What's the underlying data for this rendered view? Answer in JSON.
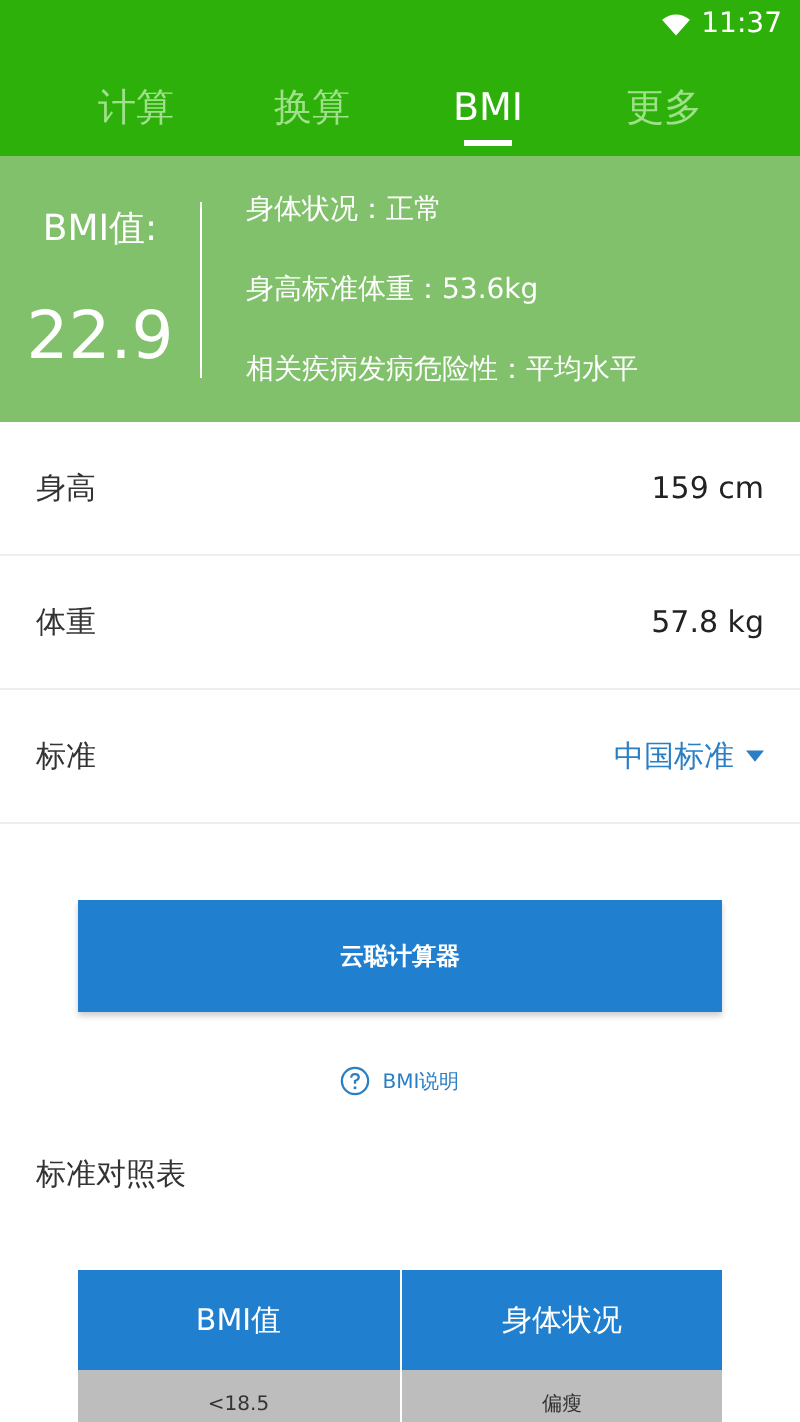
{
  "status_bar": {
    "time": "11:37"
  },
  "tabs": [
    {
      "label": "计算",
      "selected": false
    },
    {
      "label": "换算",
      "selected": false
    },
    {
      "label": "BMI",
      "selected": true
    },
    {
      "label": "更多",
      "selected": false
    }
  ],
  "result": {
    "label": "BMI值:",
    "value": "22.9",
    "details": [
      "身体状况：正常",
      "身高标准体重：53.6kg",
      "相关疾病发病危险性：平均水平"
    ]
  },
  "inputs": [
    {
      "kind": "value",
      "label": "身高",
      "value": "159 cm"
    },
    {
      "kind": "value",
      "label": "体重",
      "value": "57.8  kg"
    },
    {
      "kind": "dropdown",
      "label": "标准",
      "value": "中国标准"
    }
  ],
  "button": "云聪计算器",
  "help_link": "BMI说明",
  "table_title": "标准对照表",
  "table": {
    "columns": [
      "BMI值",
      "身体状况"
    ],
    "rows": [
      [
        "<18.5",
        "偏瘦"
      ]
    ]
  }
}
